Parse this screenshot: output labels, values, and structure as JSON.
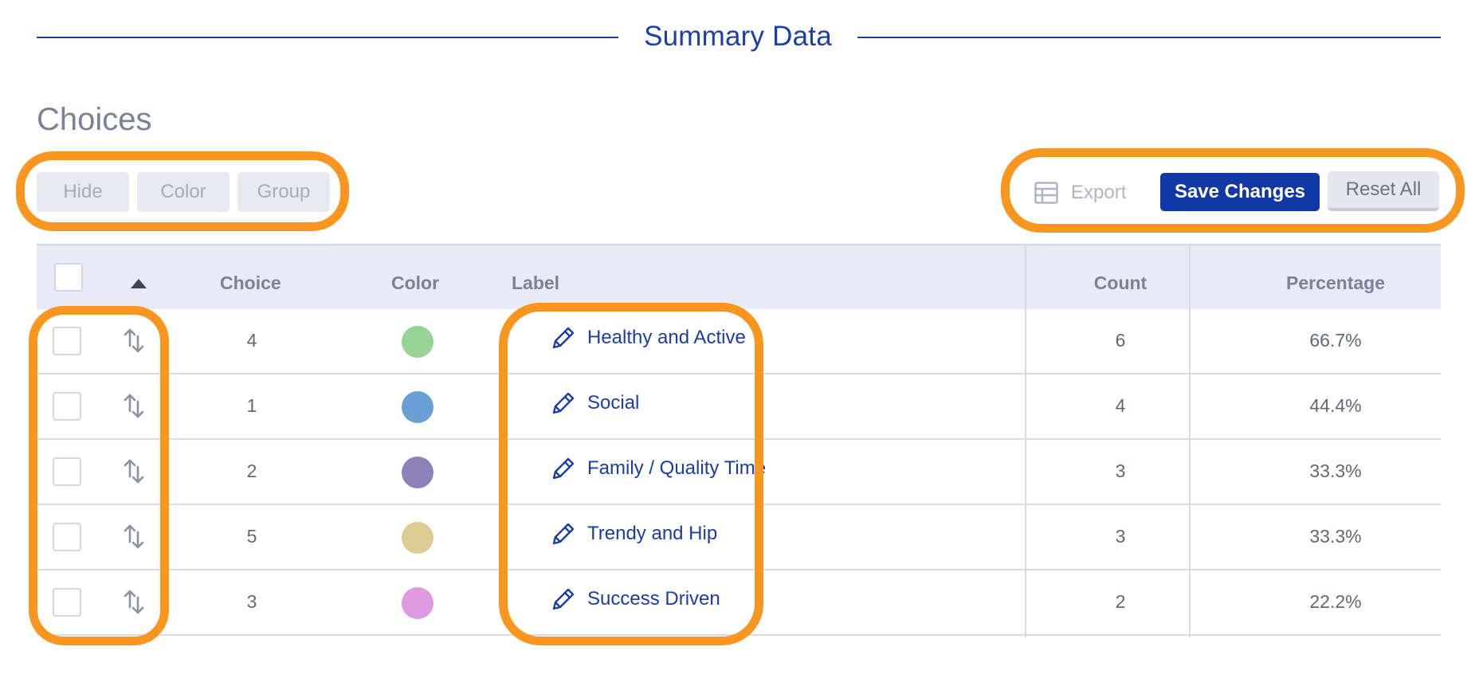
{
  "section_heading": "Summary Data",
  "choices_title": "Choices",
  "left_toolbar": {
    "hide_label": "Hide",
    "color_label": "Color",
    "group_label": "Group"
  },
  "right_toolbar": {
    "export_label": "Export",
    "save_label": "Save Changes",
    "reset_label": "Reset All"
  },
  "table": {
    "headers": {
      "choice": "Choice",
      "color": "Color",
      "label": "Label",
      "count": "Count",
      "percentage": "Percentage"
    },
    "sort_indicator_icon": "triangle-up-icon",
    "rows": [
      {
        "choice": "4",
        "color": "#97d496",
        "label": "Healthy and Active",
        "count": "6",
        "percentage": "66.7%"
      },
      {
        "choice": "1",
        "color": "#6a9fd6",
        "label": "Social",
        "count": "4",
        "percentage": "44.4%"
      },
      {
        "choice": "2",
        "color": "#8d81bb",
        "label": "Family / Quality Time",
        "count": "3",
        "percentage": "33.3%"
      },
      {
        "choice": "5",
        "color": "#decc95",
        "label": "Trendy and Hip",
        "count": "3",
        "percentage": "33.3%"
      },
      {
        "choice": "3",
        "color": "#df9be0",
        "label": "Success Driven",
        "count": "2",
        "percentage": "22.2%"
      }
    ]
  },
  "colors": {
    "accent": "#1d3fa8",
    "primary_button": "#1237a6",
    "highlight": "#f8961f",
    "header_bg": "#e8ebf7"
  },
  "icons": {
    "export": "table-icon",
    "label_edit": "pencil-icon",
    "reorder": "reorder-arrows-icon"
  }
}
